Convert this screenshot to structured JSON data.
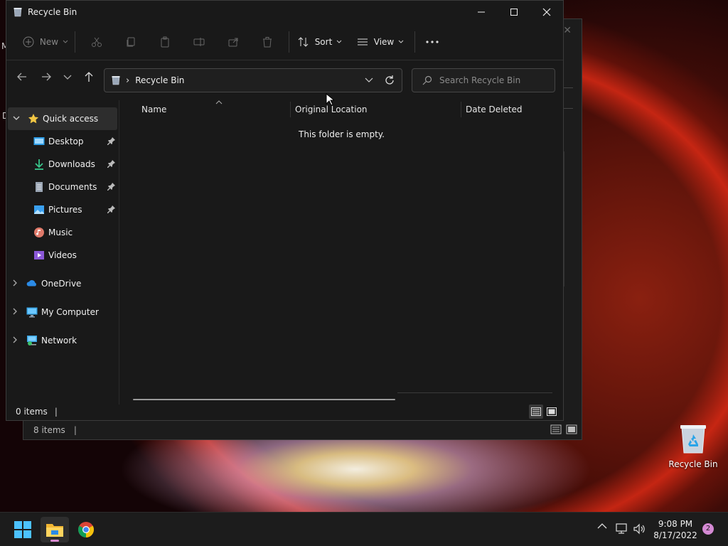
{
  "window": {
    "title": "Recycle Bin",
    "controls": [
      "minimize",
      "maximize",
      "close"
    ]
  },
  "toolbar": {
    "new_label": "New",
    "sort_label": "Sort",
    "view_label": "View"
  },
  "address": {
    "crumb": "Recycle Bin"
  },
  "search": {
    "placeholder": "Search Recycle Bin"
  },
  "sidebar": {
    "items": [
      {
        "label": "Quick access",
        "icon": "star-icon"
      },
      {
        "label": "Desktop",
        "icon": "desktop-icon",
        "pinned": true
      },
      {
        "label": "Downloads",
        "icon": "download-icon",
        "pinned": true
      },
      {
        "label": "Documents",
        "icon": "documents-icon",
        "pinned": true
      },
      {
        "label": "Pictures",
        "icon": "pictures-icon",
        "pinned": true
      },
      {
        "label": "Music",
        "icon": "music-icon"
      },
      {
        "label": "Videos",
        "icon": "videos-icon"
      },
      {
        "label": "OneDrive",
        "icon": "cloud-icon"
      },
      {
        "label": "My Computer",
        "icon": "computer-icon"
      },
      {
        "label": "Network",
        "icon": "network-icon"
      }
    ]
  },
  "columns": {
    "name": "Name",
    "original_location": "Original Location",
    "date_deleted": "Date Deleted"
  },
  "content": {
    "empty_message": "This folder is empty."
  },
  "status": {
    "item_count": "0 items",
    "separator": "|"
  },
  "background_window": {
    "item_count": "8 items",
    "separator": "|",
    "edge_text_1": "M",
    "edge_text_2": "D"
  },
  "desktop": {
    "recycle_bin_label": "Recycle Bin"
  },
  "taskbar": {
    "time": "9:08 PM",
    "date": "8/17/2022",
    "notification_count": "2"
  },
  "colors": {
    "window_bg": "#191919",
    "accent_yellow": "#f2c744",
    "accent_blue": "#3aa0f0",
    "notification_pink": "#d58ad4"
  }
}
